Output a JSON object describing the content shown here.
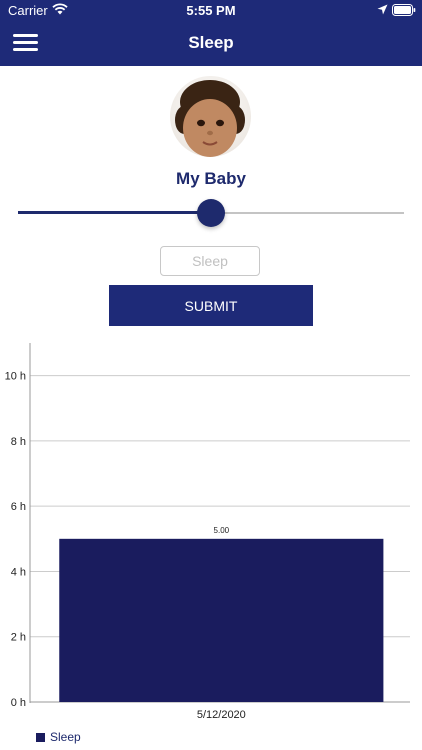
{
  "status_bar": {
    "carrier": "Carrier",
    "time": "5:55 PM"
  },
  "header": {
    "title": "Sleep",
    "menu_icon": "hamburger-menu-icon"
  },
  "profile": {
    "name": "My Baby"
  },
  "slider": {
    "value": 0.5
  },
  "sleep_input": {
    "placeholder": "Sleep",
    "value": ""
  },
  "submit": {
    "label": "SUBMIT"
  },
  "colors": {
    "primary": "#1e2a78",
    "bar": "#1a1c5e",
    "grid": "#cccccc"
  },
  "chart_data": {
    "type": "bar",
    "categories": [
      "5/12/2020"
    ],
    "series": [
      {
        "name": "Sleep",
        "values": [
          5.0
        ]
      }
    ],
    "data_labels": [
      "5.00"
    ],
    "y_ticks": [
      "0 h",
      "2 h",
      "4 h",
      "6 h",
      "8 h",
      "10 h"
    ],
    "ylim": [
      0,
      11
    ],
    "grid": true,
    "legend_position": "bottom-left"
  }
}
